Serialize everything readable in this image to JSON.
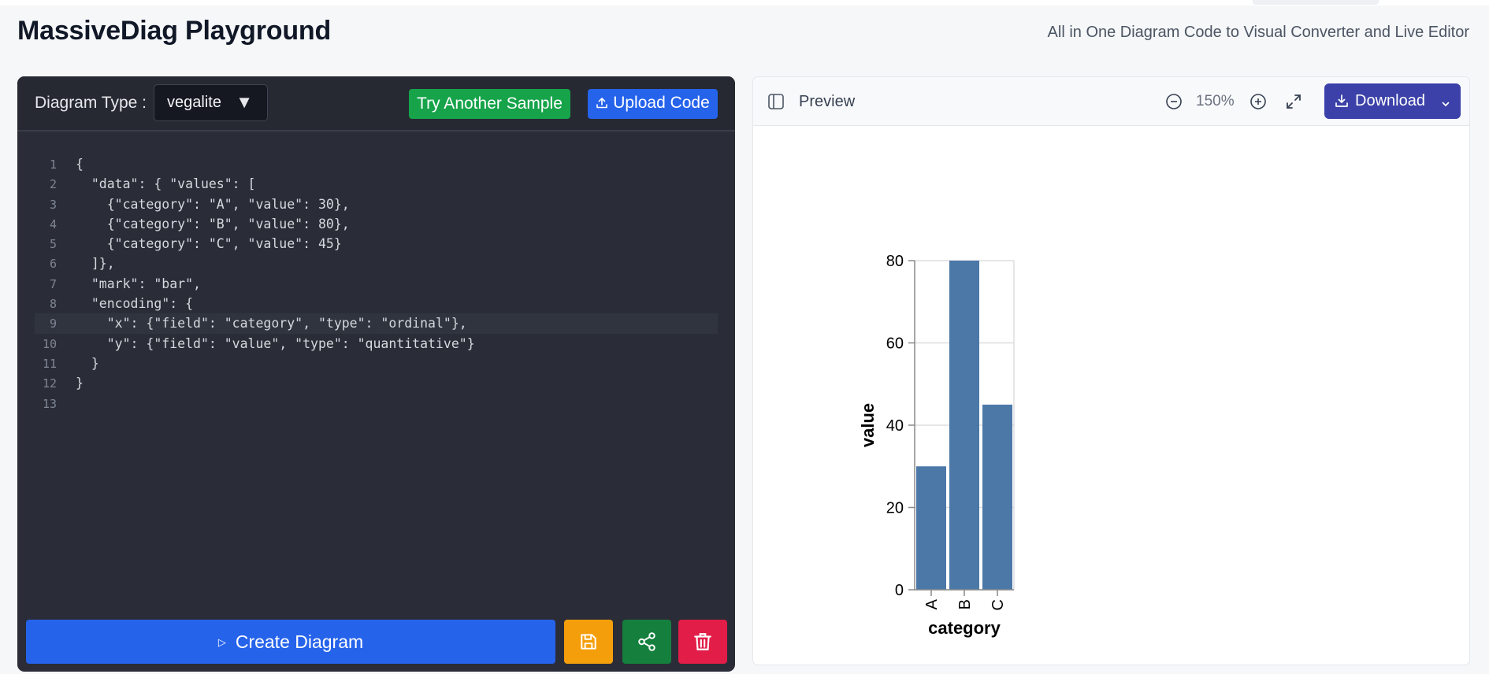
{
  "app": {
    "title": "MassiveDiag Playground",
    "subtitle": "All in One Diagram Code to Visual Converter and Live Editor"
  },
  "editor": {
    "diagram_type_label": "Diagram Type :",
    "diagram_type_value": "vegalite",
    "try_sample_label": "Try Another Sample",
    "upload_label": "Upload Code",
    "create_label": "Create Diagram",
    "active_line": 9,
    "lines": [
      "{",
      "  \"data\": { \"values\": [",
      "    {\"category\": \"A\", \"value\": 30},",
      "    {\"category\": \"B\", \"value\": 80},",
      "    {\"category\": \"C\", \"value\": 45}",
      "  ]},",
      "  \"mark\": \"bar\",",
      "  \"encoding\": {",
      "    \"x\": {\"field\": \"category\", \"type\": \"ordinal\"},",
      "    \"y\": {\"field\": \"value\", \"type\": \"quantitative\"}",
      "  }",
      "}",
      ""
    ]
  },
  "preview": {
    "label": "Preview",
    "zoom": "150%",
    "download_label": "Download"
  },
  "colors": {
    "bar": "#4c78a8",
    "create_button": "#2563eb",
    "save_button": "#f59e0b",
    "share_button": "#15803d",
    "delete_button": "#e11d48",
    "download_button": "#3b41a8"
  },
  "icons": [
    "upload-icon",
    "play-icon",
    "save-icon",
    "share-icon",
    "trash-icon",
    "sidebar-toggle-icon",
    "zoom-out-icon",
    "zoom-in-icon",
    "expand-icon",
    "download-icon",
    "chevron-down-icon"
  ],
  "chart_data": {
    "type": "bar",
    "categories": [
      "A",
      "B",
      "C"
    ],
    "values": [
      30,
      80,
      45
    ],
    "xlabel": "category",
    "ylabel": "value",
    "ylim": [
      0,
      80
    ],
    "yticks": [
      0,
      20,
      40,
      60,
      80
    ],
    "grid": true
  }
}
